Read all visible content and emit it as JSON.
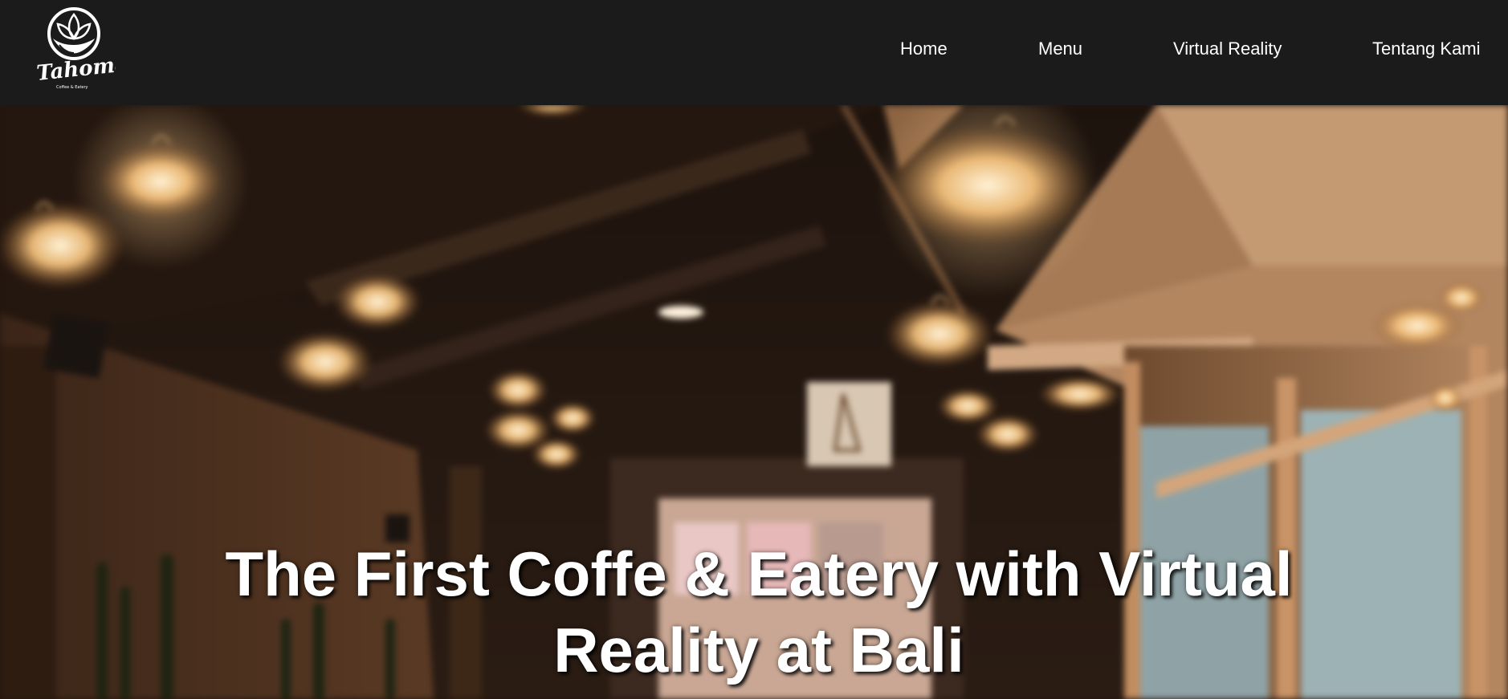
{
  "brand": {
    "logo_name": "Tahoma",
    "logo_tagline": "Coffee & Eatery"
  },
  "nav": {
    "items": [
      {
        "label": "Home"
      },
      {
        "label": "Menu"
      },
      {
        "label": "Virtual Reality"
      },
      {
        "label": "Tentang Kami"
      }
    ]
  },
  "hero": {
    "title": "The First Coffe & Eatery with Virtual Reality at Bali",
    "background_description_color": "#2a1a10"
  },
  "colors": {
    "navbar_bg": "#1b1b1b",
    "nav_text": "#ffffff",
    "hero_text": "#ffffff",
    "lamp_glow": "#f3c98a",
    "ceiling": "#1e130c",
    "wood": "#8a5a33"
  }
}
